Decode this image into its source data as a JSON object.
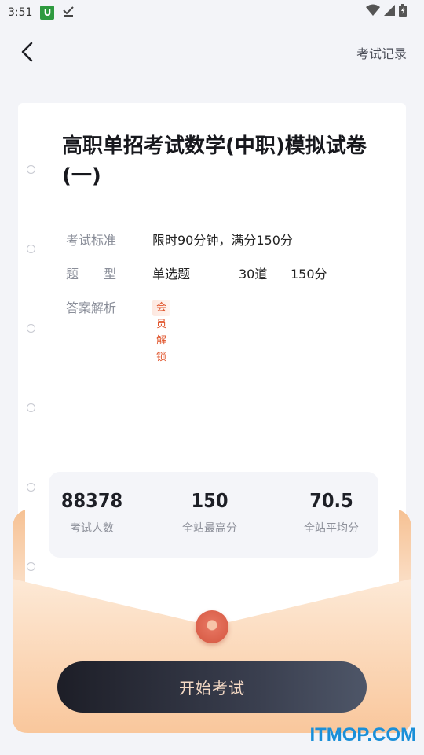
{
  "status_bar": {
    "time": "3:51",
    "notification_icon_letter": "U",
    "icons": [
      "download-done-icon",
      "wifi-icon",
      "cellular-signal-icon",
      "battery-icon"
    ]
  },
  "nav": {
    "back_icon": "chevron-left-icon",
    "record_label": "考试记录"
  },
  "exam": {
    "title": "高职单招考试数学(中职)模拟试卷(一)",
    "standard_label": "考试标准",
    "standard_value": "限时90分钟，满分150分",
    "type_label": "题　　型",
    "type_name": "单选题",
    "type_count": "30道",
    "type_score": "150分",
    "analysis_label": "答案解析",
    "analysis_badge": "会员解锁"
  },
  "stats": [
    {
      "value": "88378",
      "label": "考试人数"
    },
    {
      "value": "150",
      "label": "全站最高分"
    },
    {
      "value": "70.5",
      "label": "全站平均分"
    }
  ],
  "actions": {
    "start_label": "开始考试"
  },
  "watermark": "ITMOP.COM",
  "colors": {
    "background": "#f3f4f8",
    "accent_orange": "#e0542b",
    "envelope": "#f9c9a0",
    "button_dark": "#1d1e27",
    "watermark": "#1a8fd8"
  }
}
